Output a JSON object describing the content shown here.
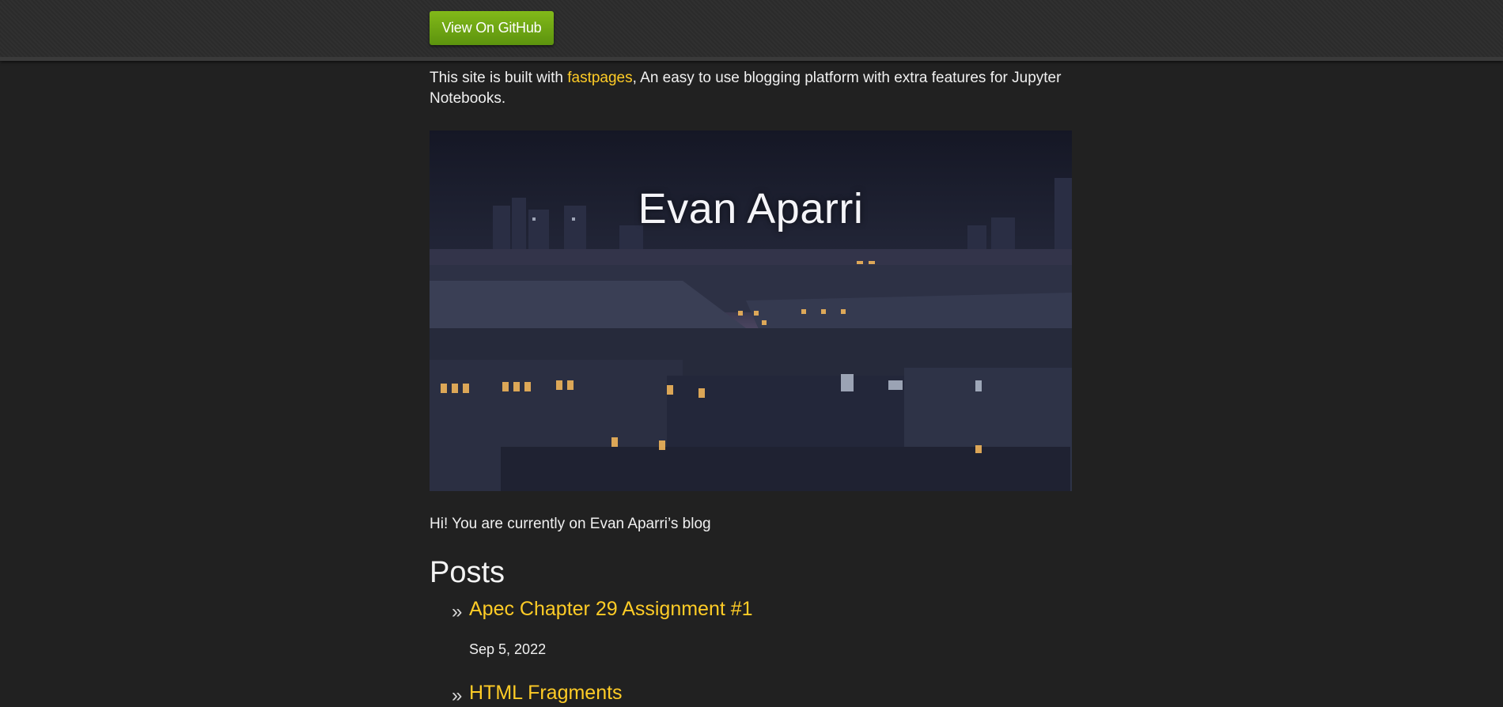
{
  "header": {
    "github_button_label": "View On GitHub"
  },
  "intro": {
    "prefix": "This site is built with ",
    "link_text": "fastpages",
    "suffix": ", An easy to use blogging platform with extra features for Jupyter Notebooks."
  },
  "banner": {
    "title": "Evan Aparri"
  },
  "greeting": "Hi! You are currently on Evan Aparri’s blog",
  "posts_heading": "Posts",
  "posts": [
    {
      "bullet": "»",
      "title": "Apec Chapter 29 Assignment #1",
      "date": "Sep 5, 2022"
    },
    {
      "bullet": "»",
      "title": "HTML Fragments",
      "date": ""
    }
  ],
  "colors": {
    "background": "#212121",
    "link": "#ffcc26",
    "button": "#6da414"
  }
}
